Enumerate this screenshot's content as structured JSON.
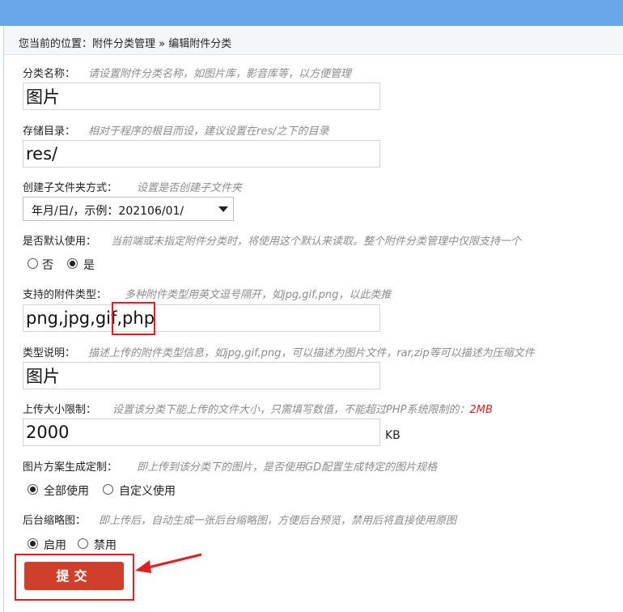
{
  "breadcrumb": "您当前的位置：附件分类管理 » 编辑附件分类",
  "fields": {
    "name": {
      "label": "分类名称：",
      "hint": "请设置附件分类名称，如图片库，影音库等，以方便管理",
      "value": "图片"
    },
    "dir": {
      "label": "存储目录：",
      "hint": "相对于程序的根目而设，建议设置在res/之下的目录",
      "value": "res/"
    },
    "subdir": {
      "label": "创建子文件夹方式：",
      "hint": "设置是否创建子文件夹",
      "selected": "年月/日/，示例：202106/01/"
    },
    "default": {
      "label": "是否默认使用：",
      "hint": "当前端或未指定附件分类时，将使用这个默认来读取。整个附件分类管理中仅限支持一个",
      "options": [
        "否",
        "是"
      ],
      "checked": "是"
    },
    "types": {
      "label": "支持的附件类型：",
      "hint": "多种附件类型用英文逗号隔开，如jpg,gif,png，以此类推",
      "value": "png,jpg,gif,php"
    },
    "typedesc": {
      "label": "类型说明：",
      "hint": "描述上传的附件类型信息，如jpg,gif,png，可以描述为图片文件，rar,zip等可以描述为压缩文件",
      "value": "图片"
    },
    "maxsize": {
      "label": "上传大小限制：",
      "hint": "设置该分类下能上传的文件大小，只需填写数值，不能超过PHP系统限制的：",
      "limit": "2MB",
      "value": "2000",
      "unit": "KB"
    },
    "gd": {
      "label": "图片方案生成定制：",
      "hint": "即上传到该分类下的图片，是否使用GD配置生成特定的图片规格",
      "options": [
        "全部使用",
        "自定义使用"
      ],
      "checked": "全部使用"
    },
    "thumb": {
      "label": "后台缩略图：",
      "hint": "即上传后，自动生成一张后台缩略图，方便后台预览，禁用后将直接使用原图",
      "options": [
        "启用",
        "禁用"
      ],
      "checked": "启用"
    }
  },
  "submit_label": "提交",
  "colors": {
    "header": "#6aa6ea",
    "button": "#cf3f2a",
    "annotation": "#e0201f"
  }
}
